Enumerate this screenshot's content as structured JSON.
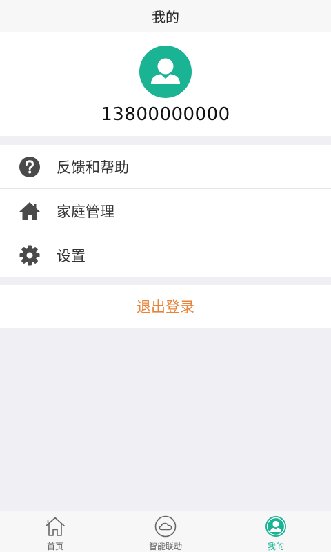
{
  "header": {
    "title": "我的"
  },
  "profile": {
    "phone": "13800000000",
    "avatar_icon": "user-avatar-icon"
  },
  "menu": {
    "items": [
      {
        "label": "反馈和帮助",
        "icon": "question-circle-icon"
      },
      {
        "label": "家庭管理",
        "icon": "home-icon"
      },
      {
        "label": "设置",
        "icon": "gear-icon"
      }
    ]
  },
  "logout": {
    "label": "退出登录"
  },
  "tabbar": {
    "tabs": [
      {
        "label": "首页",
        "icon": "home-outline-icon",
        "active": false
      },
      {
        "label": "智能联动",
        "icon": "cloud-circle-icon",
        "active": false
      },
      {
        "label": "我的",
        "icon": "user-circle-icon",
        "active": true
      }
    ]
  },
  "colors": {
    "accent": "#1ab394",
    "logout": "#e8843a",
    "background": "#efeff4",
    "icon": "#4a4a4a"
  }
}
